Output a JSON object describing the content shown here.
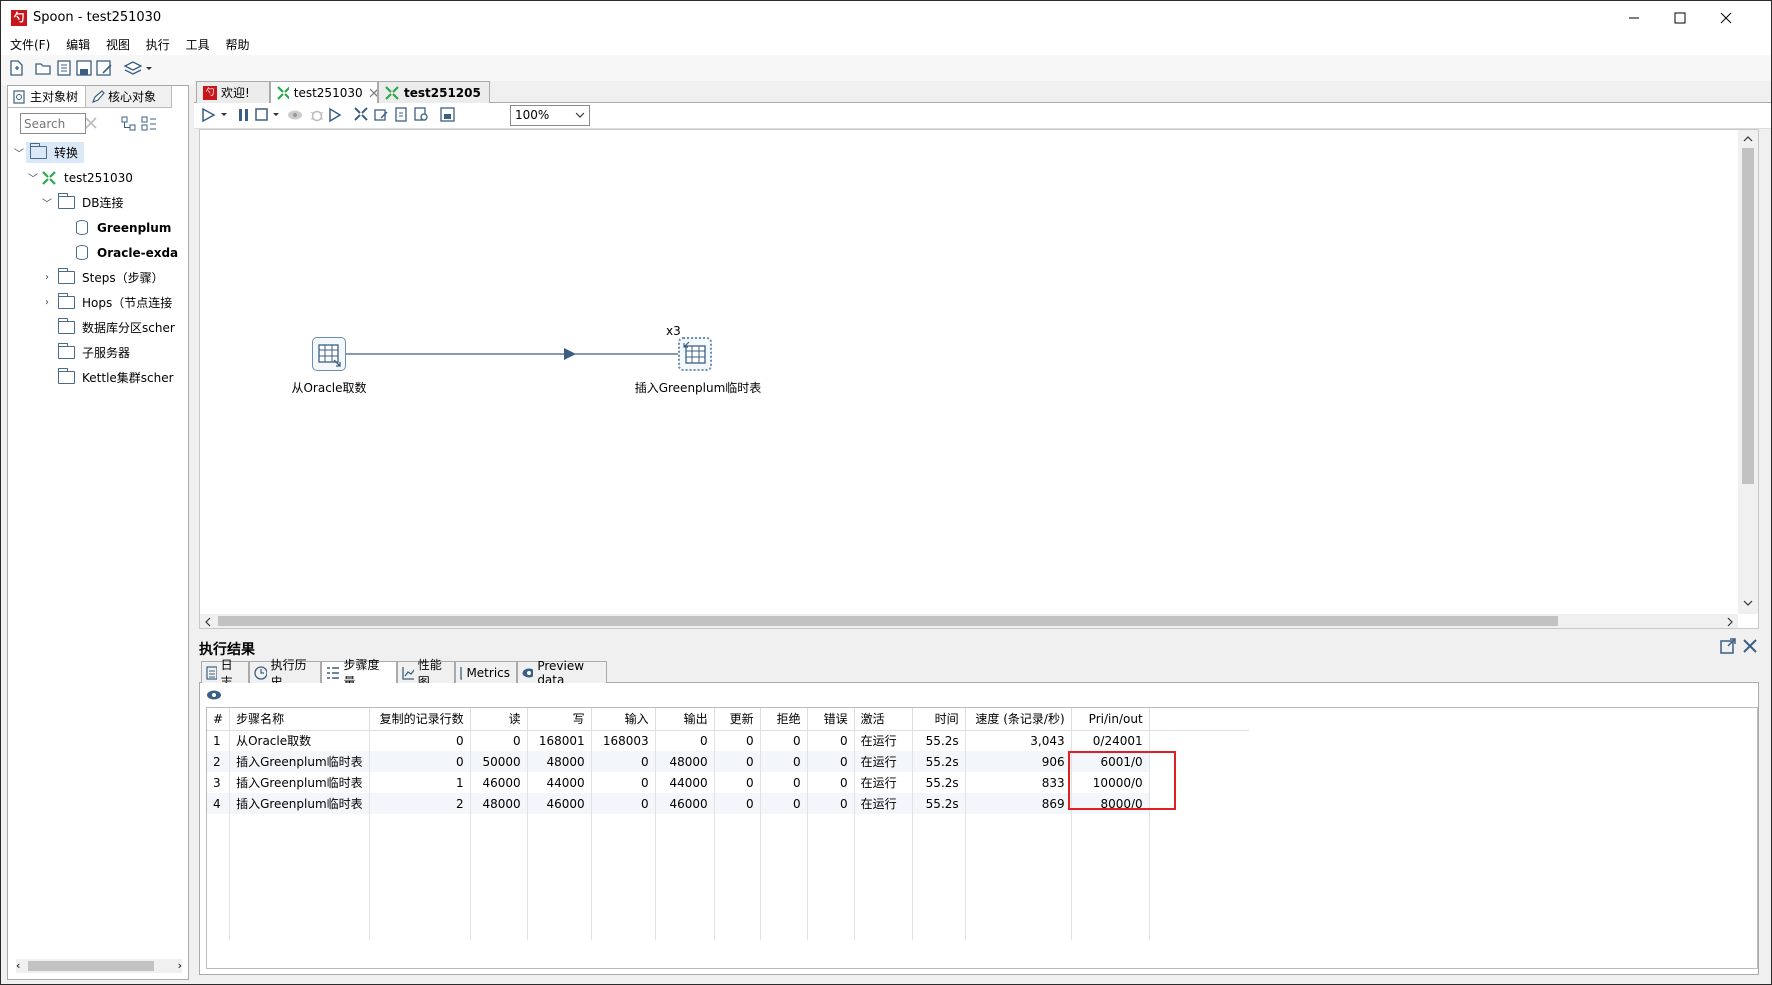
{
  "window": {
    "app_icon": "spoon-icon",
    "title": "Spoon - test251030"
  },
  "menubar": [
    "文件(F)",
    "编辑",
    "视图",
    "执行",
    "工具",
    "帮助"
  ],
  "left_panel": {
    "tabs": [
      "主对象树",
      "核心对象"
    ],
    "search_placeholder": "Search",
    "tree": {
      "root": "转换",
      "transformation": "test251030",
      "db_folder": "DB连接",
      "db_connections": [
        "Greenplum",
        "Oracle-exda"
      ],
      "steps_folder": "Steps（步骤）",
      "hops_folder": "Hops（节点连接",
      "partition_folder": "数据库分区scher",
      "slave_folder": "子服务器",
      "cluster_folder": "Kettle集群scher"
    }
  },
  "editor_tabs": [
    "欢迎!",
    "test251030",
    "test251205"
  ],
  "zoom": "100%",
  "canvas": {
    "step1_label": "从Oracle取数",
    "step2_label": "插入Greenplum临时表",
    "step2_copies": "x3"
  },
  "results": {
    "title": "执行结果",
    "tabs": [
      "日志",
      "执行历史",
      "步骤度量",
      "性能图",
      "Metrics",
      "Preview data"
    ],
    "columns": [
      "#",
      "步骤名称",
      "复制的记录行数",
      "读",
      "写",
      "输入",
      "输出",
      "更新",
      "拒绝",
      "错误",
      "激活",
      "时间",
      "速度 (条记录/秒)",
      "Pri/in/out"
    ],
    "rows": [
      [
        "1",
        "从Oracle取数",
        "0",
        "0",
        "168001",
        "168003",
        "0",
        "0",
        "0",
        "0",
        "在运行",
        "55.2s",
        "3,043",
        "0/24001"
      ],
      [
        "2",
        "插入Greenplum临时表",
        "0",
        "50000",
        "48000",
        "0",
        "48000",
        "0",
        "0",
        "0",
        "在运行",
        "55.2s",
        "906",
        "6001/0"
      ],
      [
        "3",
        "插入Greenplum临时表",
        "1",
        "46000",
        "44000",
        "0",
        "44000",
        "0",
        "0",
        "0",
        "在运行",
        "55.2s",
        "833",
        "10000/0"
      ],
      [
        "4",
        "插入Greenplum临时表",
        "2",
        "48000",
        "46000",
        "0",
        "46000",
        "0",
        "0",
        "0",
        "在运行",
        "55.2s",
        "869",
        "8000/0"
      ]
    ],
    "highlight_color": "#e02020"
  }
}
